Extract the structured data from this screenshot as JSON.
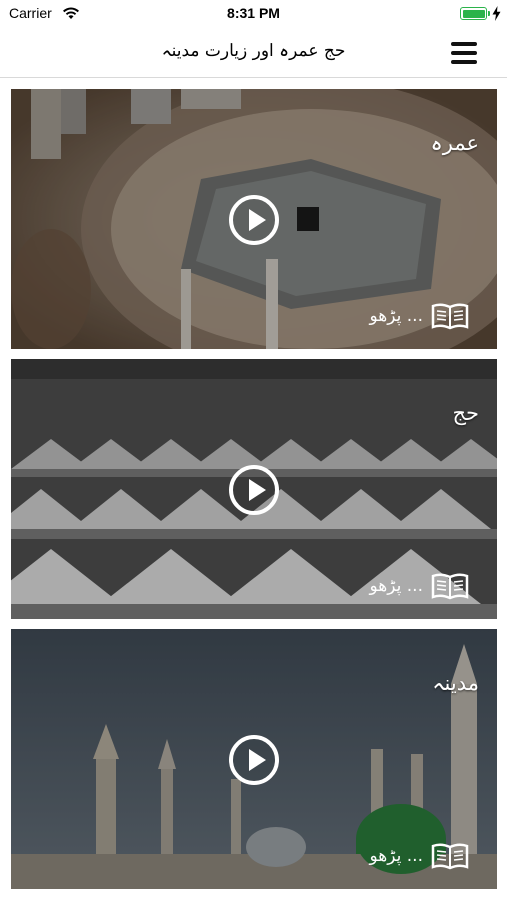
{
  "status_bar": {
    "carrier": "Carrier",
    "time": "8:31 PM",
    "battery_level": 1.0
  },
  "nav": {
    "title": "حج عمرہ اور زیارت مدینہ"
  },
  "cards": [
    {
      "title": "عمرہ",
      "read_label": "پڑھو ..."
    },
    {
      "title": "حج",
      "read_label": "پڑھو ..."
    },
    {
      "title": "مدینہ",
      "read_label": "پڑھو ..."
    }
  ],
  "colors": {
    "battery": "#2bb34a",
    "overlay_text": "#ffffff"
  }
}
